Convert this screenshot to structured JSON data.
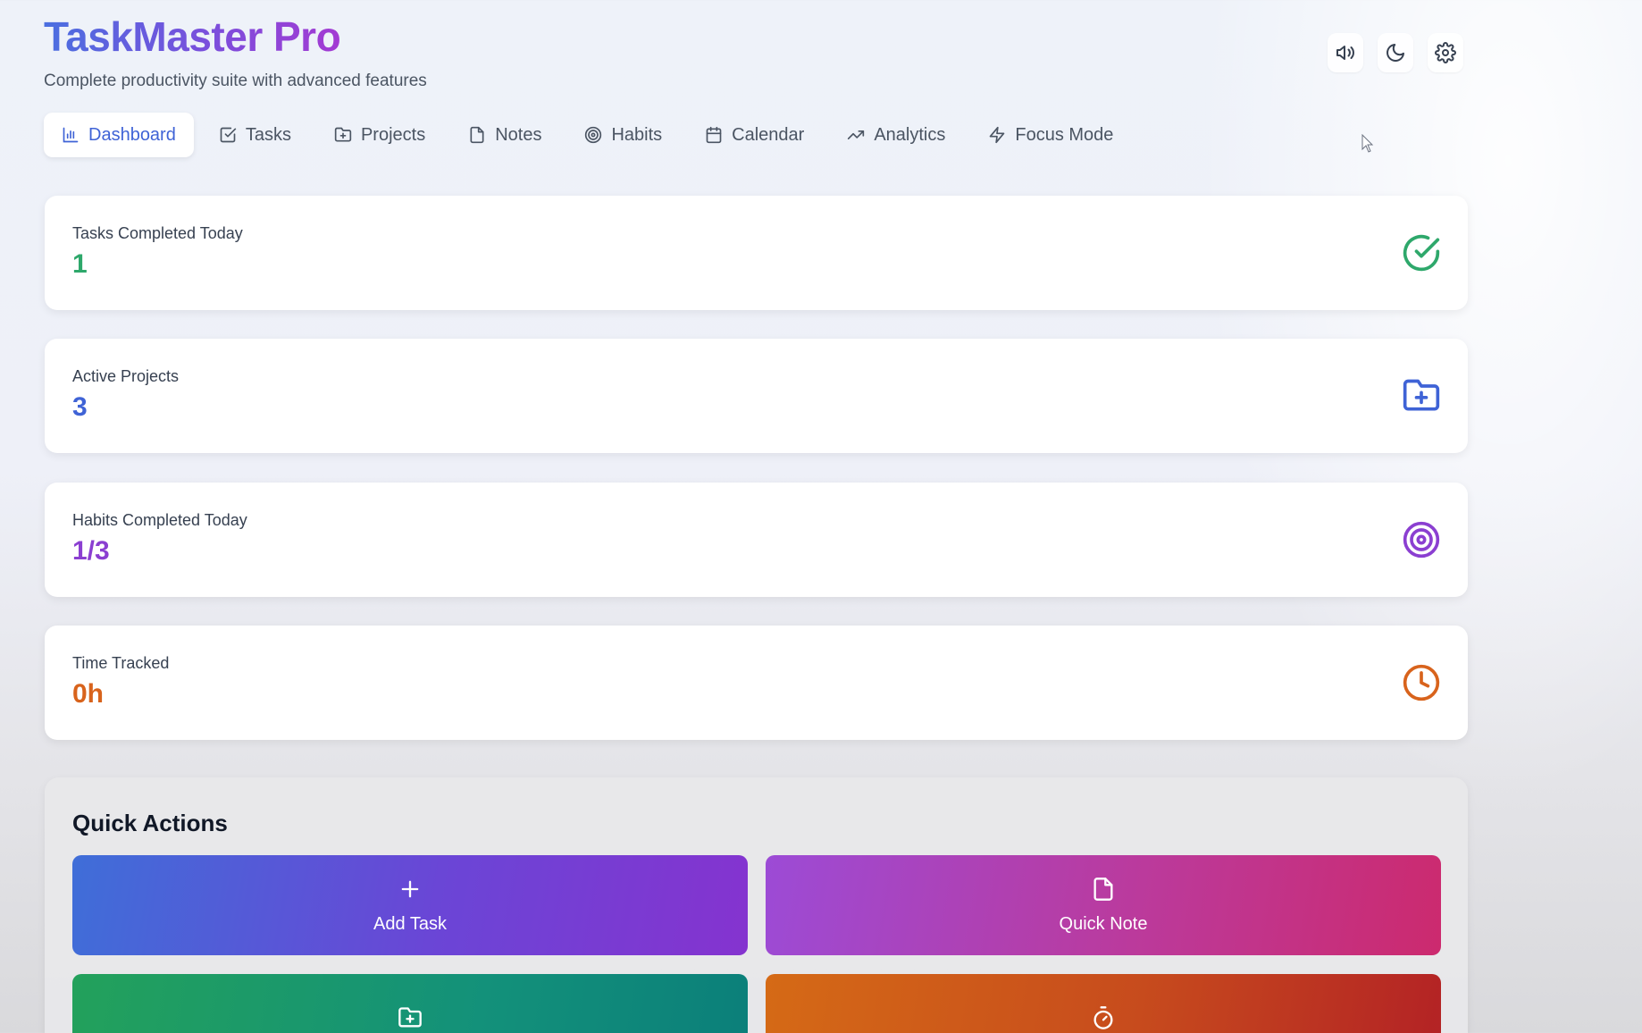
{
  "header": {
    "title": "TaskMaster Pro",
    "subtitle": "Complete productivity suite with advanced features"
  },
  "top_actions": [
    {
      "icon": "speaker-icon"
    },
    {
      "icon": "moon-icon"
    },
    {
      "icon": "gear-icon"
    }
  ],
  "tabs": [
    {
      "label": "Dashboard",
      "icon": "bar-chart-icon",
      "active": true
    },
    {
      "label": "Tasks",
      "icon": "checkbox-icon"
    },
    {
      "label": "Projects",
      "icon": "folder-plus-icon"
    },
    {
      "label": "Notes",
      "icon": "file-icon"
    },
    {
      "label": "Habits",
      "icon": "target-icon"
    },
    {
      "label": "Calendar",
      "icon": "calendar-icon"
    },
    {
      "label": "Analytics",
      "icon": "trending-up-icon"
    },
    {
      "label": "Focus Mode",
      "icon": "zap-icon"
    }
  ],
  "stats": [
    {
      "label": "Tasks Completed Today",
      "value": "1",
      "color": "#2ea86b",
      "icon": "check-circle-icon"
    },
    {
      "label": "Active Projects",
      "value": "3",
      "color": "#3f63d6",
      "icon": "folder-plus-icon"
    },
    {
      "label": "Habits Completed Today",
      "value": "1/3",
      "color": "#8b3fd1",
      "icon": "target-icon"
    },
    {
      "label": "Time Tracked",
      "value": "0h",
      "color": "#d8631c",
      "icon": "clock-icon"
    }
  ],
  "quick_actions": {
    "title": "Quick Actions",
    "buttons": [
      {
        "label": "Add Task",
        "icon": "plus-icon"
      },
      {
        "label": "Quick Note",
        "icon": "file-icon"
      },
      {
        "label": "",
        "icon": "folder-plus-icon"
      },
      {
        "label": "",
        "icon": "timer-icon"
      }
    ]
  }
}
